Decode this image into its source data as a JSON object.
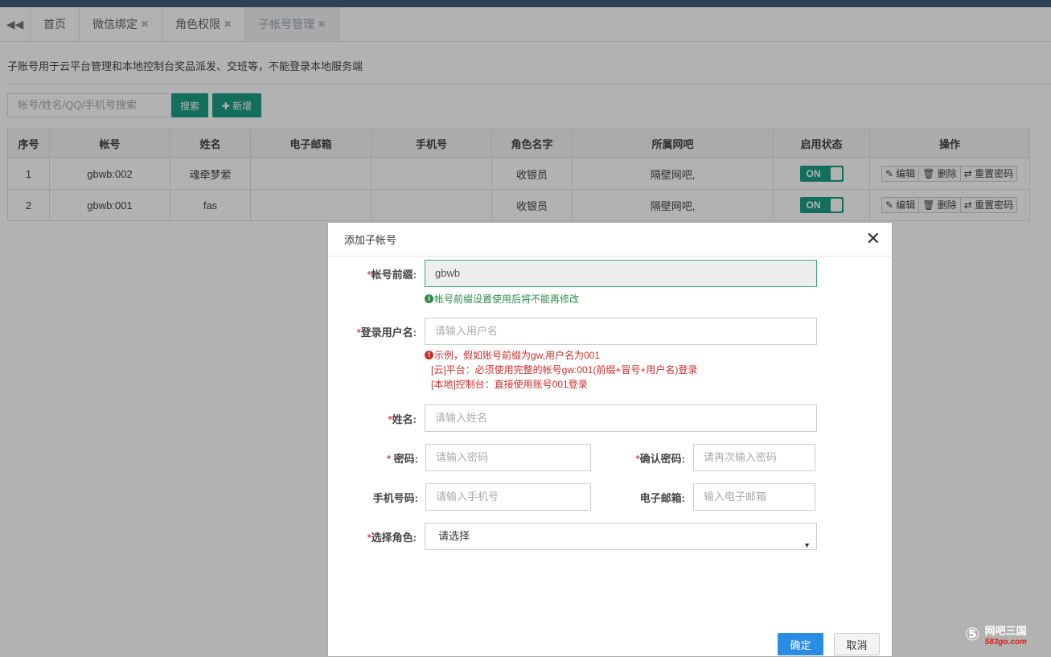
{
  "tabs": {
    "back_icon": "double-chevron-left-icon",
    "items": [
      {
        "label": "首页",
        "closable": false,
        "active": false
      },
      {
        "label": "微信绑定",
        "closable": true,
        "active": false
      },
      {
        "label": "角色权限",
        "closable": true,
        "active": false
      },
      {
        "label": "子帐号管理",
        "closable": true,
        "active": true
      }
    ],
    "close_glyph": "✖"
  },
  "page": {
    "notice": "子账号用于云平台管理和本地控制台奖品派发、交班等，不能登录本地服务端",
    "search_placeholder": "帐号/姓名/QQ/手机号搜索",
    "search_button": "搜索",
    "add_button": "✚ 新增"
  },
  "table": {
    "headers": [
      "序号",
      "帐号",
      "姓名",
      "电子邮箱",
      "手机号",
      "角色名字",
      "所属网吧",
      "启用状态",
      "操作"
    ],
    "rows": [
      {
        "index": "1",
        "account": "gbwb:002",
        "name": "魂牵梦萦",
        "email": "",
        "phone": "",
        "role": "收银员",
        "cafe": "隔壁网吧,",
        "status": "ON"
      },
      {
        "index": "2",
        "account": "gbwb:001",
        "name": "fas",
        "email": "",
        "phone": "",
        "role": "收银员",
        "cafe": "隔壁网吧,",
        "status": "ON"
      }
    ],
    "actions": {
      "edit": "✎ 编辑",
      "delete": "🗑 删除",
      "reset": "⇄ 重置密码"
    }
  },
  "modal": {
    "title": "添加子帐号",
    "close_glyph": "✕",
    "required_mark": "*",
    "prefix_label": "帐号前缀:",
    "prefix_value": "gbwb",
    "prefix_hint": "帐号前缀设置使用后将不能再修改",
    "username_label": "登录用户名:",
    "username_placeholder": "请输入用户名",
    "username_hint_1": "示例，假如账号前缀为gw,用户名为001",
    "username_hint_2": "[云]平台：必须使用完整的帐号gw:001(前缀+冒号+用户名)登录",
    "username_hint_3": "[本地]控制台：直接使用账号001登录",
    "name_label": "姓名:",
    "name_placeholder": "请输入姓名",
    "password_label": " 密码:",
    "password_placeholder": "请输入密码",
    "confirm_label": "确认密码:",
    "confirm_placeholder": "请再次输入密码",
    "phone_label": "手机号码:",
    "phone_placeholder": "请输入手机号",
    "email_label": "电子邮箱:",
    "email_placeholder": "输入电子邮箱",
    "role_label": "选择角色:",
    "role_value": "请选择",
    "ok_button": "确定",
    "cancel_button": "取消"
  },
  "watermark": {
    "logo": "⑤",
    "line1": "网吧三国",
    "line2": "583go.com"
  }
}
